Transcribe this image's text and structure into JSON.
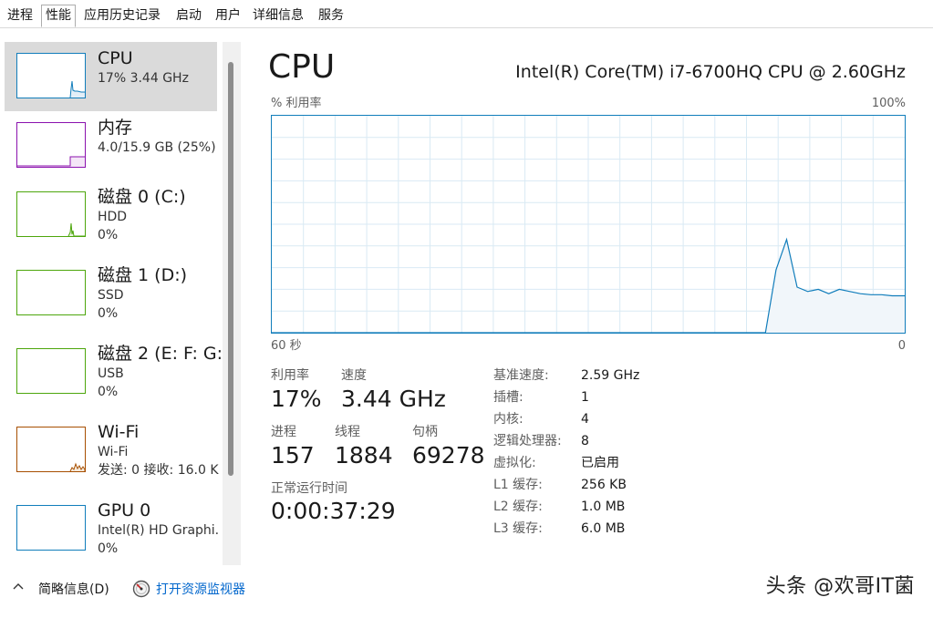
{
  "tabs": [
    {
      "label": "进程",
      "active": false
    },
    {
      "label": "性能",
      "active": true
    },
    {
      "label": "应用历史记录",
      "active": false
    },
    {
      "label": "启动",
      "active": false
    },
    {
      "label": "用户",
      "active": false
    },
    {
      "label": "详细信息",
      "active": false
    },
    {
      "label": "服务",
      "active": false
    }
  ],
  "sidebar": {
    "items": [
      {
        "name": "CPU",
        "lines": [
          "17% 3.44 GHz"
        ],
        "color": "#117dbb",
        "selected": true
      },
      {
        "name": "内存",
        "lines": [
          "4.0/15.9 GB (25%)"
        ],
        "color": "#8b12ae",
        "selected": false
      },
      {
        "name": "磁盘 0 (C:)",
        "lines": [
          "HDD",
          "0%"
        ],
        "color": "#4da60c",
        "selected": false
      },
      {
        "name": "磁盘 1 (D:)",
        "lines": [
          "SSD",
          "0%"
        ],
        "color": "#4da60c",
        "selected": false
      },
      {
        "name": "磁盘 2 (E: F: G:",
        "lines": [
          "USB",
          "0%"
        ],
        "color": "#4da60c",
        "selected": false
      },
      {
        "name": "Wi-Fi",
        "lines": [
          "Wi-Fi",
          "发送: 0 接收: 16.0 K"
        ],
        "color": "#a74f01",
        "selected": false
      },
      {
        "name": "GPU 0",
        "lines": [
          "Intel(R) HD Graphi.",
          "0%"
        ],
        "color": "#117dbb",
        "selected": false
      }
    ]
  },
  "main": {
    "title": "CPU",
    "model": "Intel(R) Core(TM) i7-6700HQ CPU @ 2.60GHz",
    "graph": {
      "ylabel": "% 利用率",
      "ymax_label": "100%",
      "x_left_label": "60 秒",
      "x_right_label": "0",
      "line_color": "#117dbb",
      "fill_color": "#f1f6fa",
      "grid_color": "#d9eaf4"
    },
    "stats": {
      "utilization_label": "利用率",
      "utilization_value": "17%",
      "speed_label": "速度",
      "speed_value": "3.44 GHz",
      "processes_label": "进程",
      "processes_value": "157",
      "threads_label": "线程",
      "threads_value": "1884",
      "handles_label": "句柄",
      "handles_value": "69278",
      "uptime_label": "正常运行时间",
      "uptime_value": "0:00:37:29"
    },
    "specs": [
      {
        "key": "基准速度:",
        "value": "2.59 GHz"
      },
      {
        "key": "插槽:",
        "value": "1"
      },
      {
        "key": "内核:",
        "value": "4"
      },
      {
        "key": "逻辑处理器:",
        "value": "8"
      },
      {
        "key": "虚拟化:",
        "value": "已启用"
      },
      {
        "key": "L1 缓存:",
        "value": "256 KB"
      },
      {
        "key": "L2 缓存:",
        "value": "1.0 MB"
      },
      {
        "key": "L3 缓存:",
        "value": "6.0 MB"
      }
    ]
  },
  "footer": {
    "brief_label": "简略信息(D)",
    "monitor_label": "打开资源监视器",
    "watermark": "头条 @欢哥IT菌"
  },
  "chart_data": {
    "type": "area",
    "xlabel": "",
    "ylabel": "% 利用率",
    "ylim": [
      0,
      100
    ],
    "xlim": [
      60,
      0
    ],
    "grid": true,
    "series": [
      {
        "x": [
          60,
          55,
          50,
          45,
          40,
          35,
          30,
          25,
          20,
          15,
          13.2,
          12.2,
          11.2,
          10.2,
          9.2,
          8.2,
          7.2,
          6.2,
          5.2,
          4.2,
          3.2,
          2.2,
          1.2,
          0
        ],
        "values": [
          0,
          0,
          0,
          0,
          0,
          0,
          0,
          0,
          0,
          0,
          0,
          29,
          43,
          21,
          19,
          20,
          18,
          20,
          19,
          18,
          17.5,
          17.5,
          17,
          17
        ]
      }
    ]
  }
}
